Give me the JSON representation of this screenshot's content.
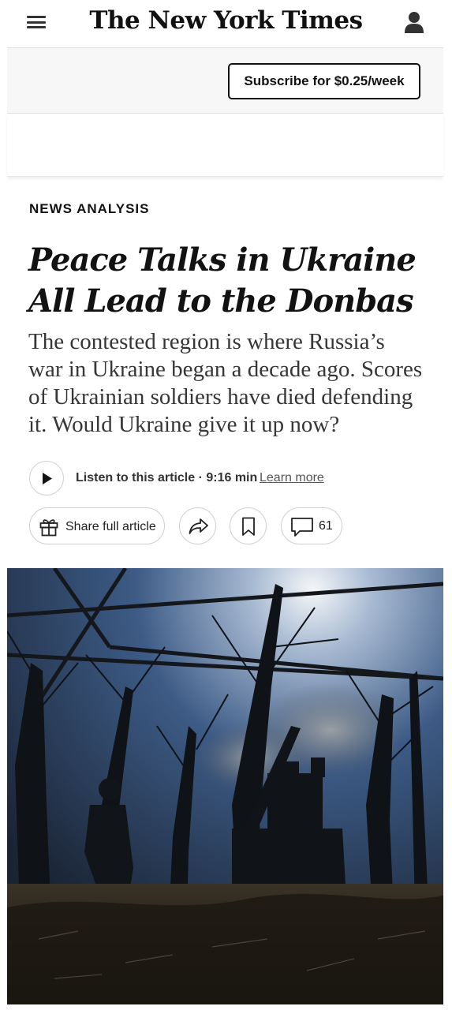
{
  "header": {
    "logo_text": "The New York Times",
    "menu_icon": "hamburger-menu-icon",
    "account_icon": "user-account-icon"
  },
  "subscribe": {
    "label": "Subscribe for $0.25/week"
  },
  "article": {
    "kicker": "NEWS ANALYSIS",
    "headline": "Peace Talks in Ukraine All Lead to the Donbas",
    "summary": "The contested region is where Russia’s war in Ukraine began a decade ago. Scores of Ukrainian soldiers have died defending it. Would Ukraine give it up now?"
  },
  "audio": {
    "listen_label": "Listen to this article · 9:16 min",
    "learn_more": "Learn more",
    "play_icon": "play-icon"
  },
  "actions": {
    "share_full_label": "Share full article",
    "gift_icon": "gift-icon",
    "share_icon": "share-arrow-icon",
    "bookmark_icon": "bookmark-icon",
    "comment_icon": "comment-bubble-icon",
    "comment_count": "61"
  },
  "photo": {
    "icon": "lead-photo-artillery-in-forest"
  },
  "colors": {
    "text": "#121212",
    "summary_text": "#363636",
    "band_bg": "#f7f7f7",
    "border": "#d0d0d0"
  }
}
